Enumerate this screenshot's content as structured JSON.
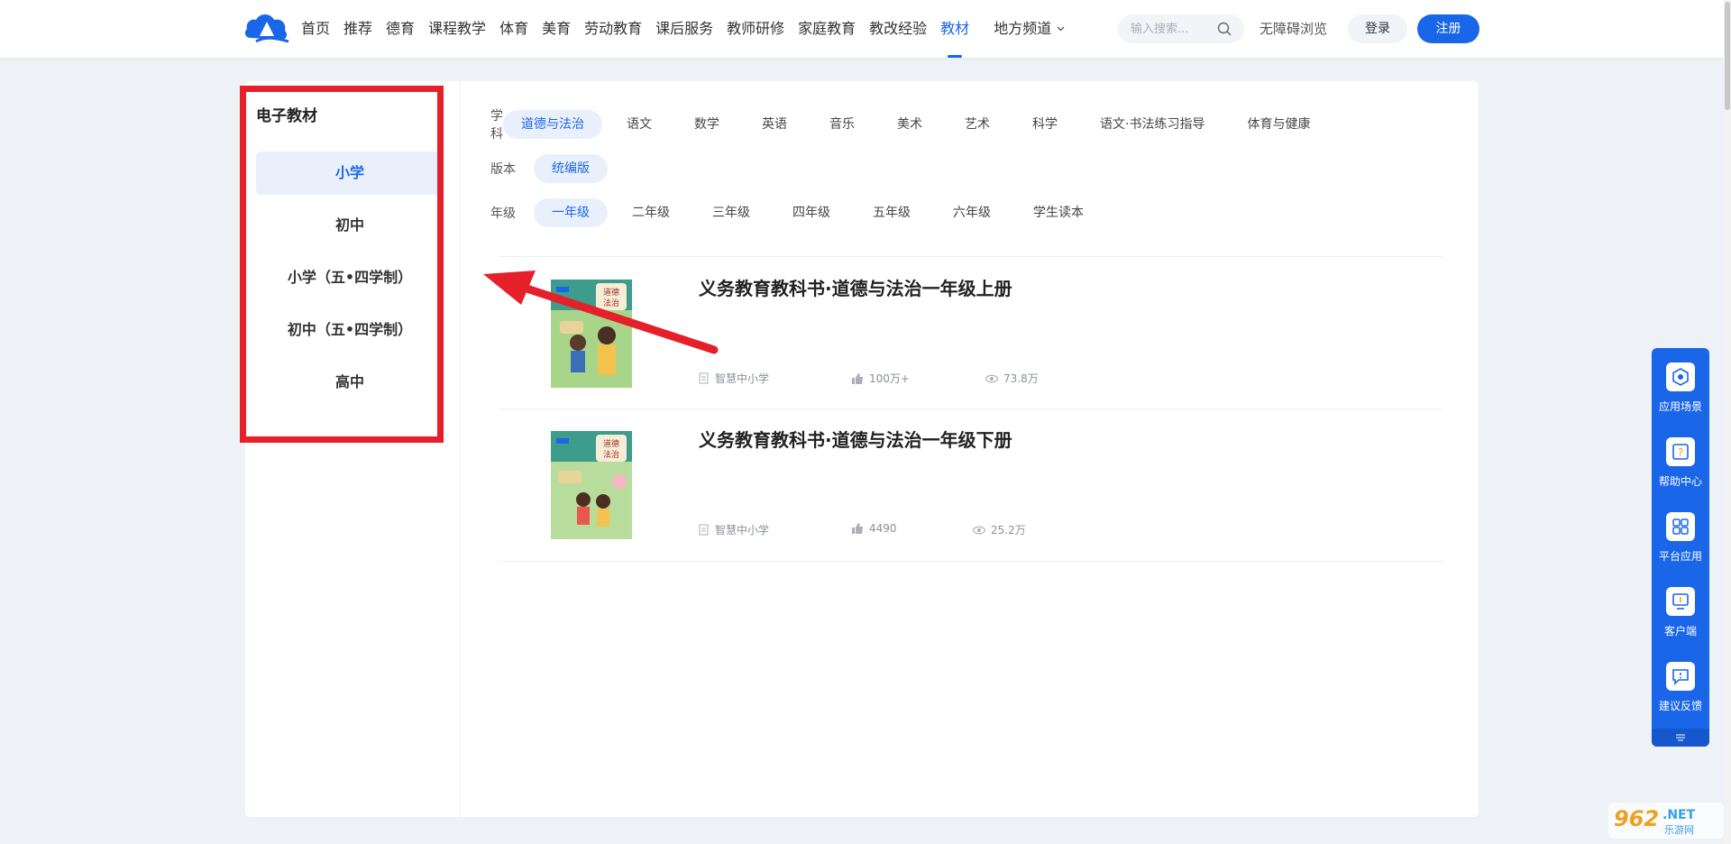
{
  "header": {
    "nav": [
      {
        "label": "首页",
        "active": false
      },
      {
        "label": "推荐",
        "active": false
      },
      {
        "label": "德育",
        "active": false
      },
      {
        "label": "课程教学",
        "active": false
      },
      {
        "label": "体育",
        "active": false
      },
      {
        "label": "美育",
        "active": false
      },
      {
        "label": "劳动教育",
        "active": false
      },
      {
        "label": "课后服务",
        "active": false
      },
      {
        "label": "教师研修",
        "active": false
      },
      {
        "label": "家庭教育",
        "active": false
      },
      {
        "label": "教改经验",
        "active": false
      },
      {
        "label": "教材",
        "active": true
      }
    ],
    "local_channel": "地方频道",
    "search_placeholder": "输入搜索...",
    "accessibility": "无障碍浏览",
    "login": "登录",
    "register": "注册"
  },
  "sidebar": {
    "title": "电子教材",
    "items": [
      {
        "label": "小学",
        "active": true
      },
      {
        "label": "初中",
        "active": false
      },
      {
        "label": "小学（五•四学制）",
        "active": false
      },
      {
        "label": "初中（五•四学制）",
        "active": false
      },
      {
        "label": "高中",
        "active": false
      }
    ]
  },
  "filters": {
    "subject": {
      "label": "学科",
      "options": [
        "道德与法治",
        "语文",
        "数学",
        "英语",
        "音乐",
        "美术",
        "艺术",
        "科学",
        "语文·书法练习指导",
        "体育与健康"
      ],
      "selected": "道德与法治"
    },
    "edition": {
      "label": "版本",
      "options": [
        "统编版"
      ],
      "selected": "统编版"
    },
    "grade": {
      "label": "年级",
      "options": [
        "一年级",
        "二年级",
        "三年级",
        "四年级",
        "五年级",
        "六年级",
        "学生读本"
      ],
      "selected": "一年级"
    }
  },
  "books": [
    {
      "title": "义务教育教科书·道德与法治一年级上册",
      "source": "智慧中小学",
      "likes": "100万+",
      "views": "73.8万"
    },
    {
      "title": "义务教育教科书·道德与法治一年级下册",
      "source": "智慧中小学",
      "likes": "4490",
      "views": "25.2万"
    }
  ],
  "dock": {
    "items": [
      {
        "label": "应用场景",
        "icon": "scene-icon"
      },
      {
        "label": "帮助中心",
        "icon": "help-icon"
      },
      {
        "label": "平台应用",
        "icon": "apps-icon"
      },
      {
        "label": "客户端",
        "icon": "client-icon"
      },
      {
        "label": "建议反馈",
        "icon": "feedback-icon"
      }
    ]
  },
  "colors": {
    "accent": "#1a66e8",
    "highlight": "#e5202b",
    "background": "#eef1f6"
  }
}
